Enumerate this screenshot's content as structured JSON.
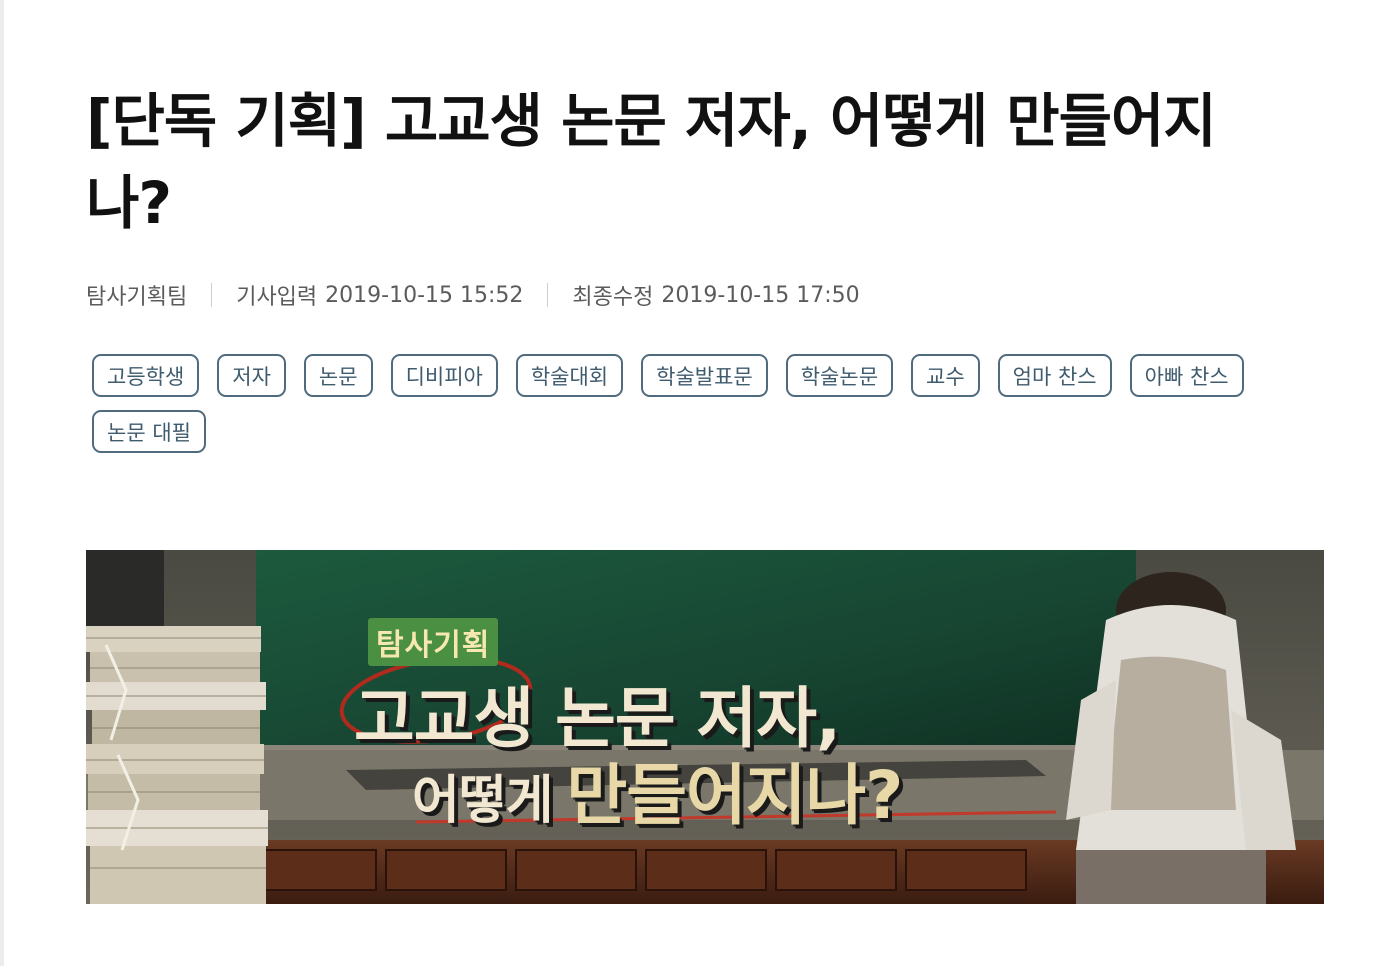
{
  "article": {
    "title": "[단독 기획] 고교생 논문 저자, 어떻게 만들어지나?",
    "byline": "탐사기획팀",
    "published_label": "기사입력",
    "published_at": "2019-10-15 15:52",
    "modified_label": "최종수정",
    "modified_at": "2019-10-15 17:50"
  },
  "tags": [
    "고등학생",
    "저자",
    "논문",
    "디비피아",
    "학술대회",
    "학술발표문",
    "학술논문",
    "교수",
    "엄마 찬스",
    "아빠 찬스",
    "논문 대필"
  ],
  "hero_image": {
    "kicker": "탐사기획",
    "line1": "고교생 논문 저자,",
    "line2_prefix": "어떻게",
    "line2_main": "만들어지나?"
  },
  "colors": {
    "tag_border": "#4f6b7d",
    "tag_text": "#3f5b6e",
    "chalkboard": "#1f4d36"
  }
}
